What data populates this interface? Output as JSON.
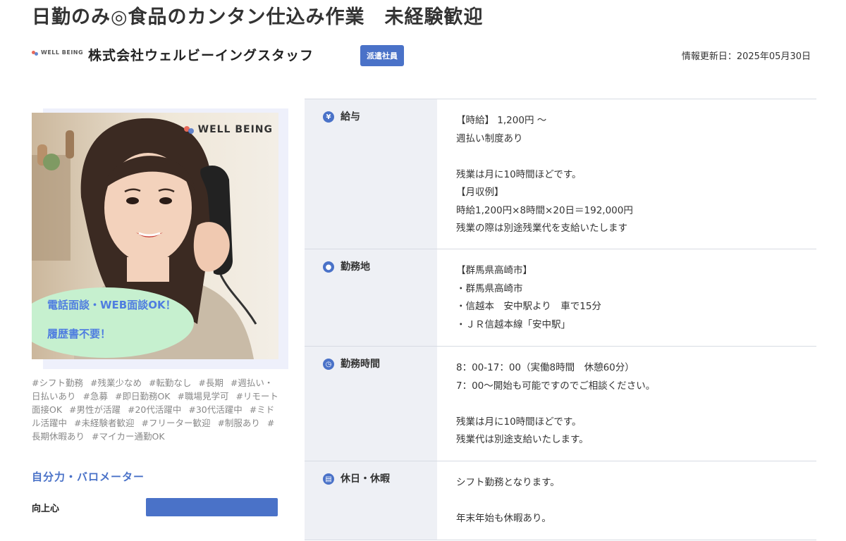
{
  "job": {
    "title": "日勤のみ◎食品のカンタン仕込み作業　未経験歓迎"
  },
  "company": {
    "logo_text": "WELL BEING",
    "name": "株式会社ウェルビーイングスタッフ",
    "employment_type": "派遣社員",
    "updated": "情報更新日：2025年05月30日"
  },
  "photo": {
    "brand": "WELL BEING",
    "bubble_line1": "電話面談・WEB面談OK！",
    "bubble_line2": "履歴書不要！"
  },
  "tags": [
    "#シフト勤務",
    "#残業少なめ",
    "#転勤なし",
    "#長期",
    "#週払い・日払いあり",
    "#急募",
    "#即日勤務OK",
    "#職場見学可",
    "#リモート面接OK",
    "#男性が活躍",
    "#20代活躍中",
    "#30代活躍中",
    "#ミドル活躍中",
    "#未経験者歓迎",
    "#フリーター歓迎",
    "#制服あり",
    "#長期休暇あり",
    "#マイカー通勤OK"
  ],
  "barometer": {
    "title": "自分力・バロメーター",
    "items": [
      {
        "label": "向上心",
        "level": 1.0
      }
    ]
  },
  "details": [
    {
      "icon": "yen-icon",
      "icon_glyph": "¥",
      "label": "給与",
      "lines": [
        "【時給】 1,200円 ～",
        "週払い制度あり",
        "",
        "残業は月に10時間ほどです。",
        "【月収例】",
        "時給1,200円×8時間×20日＝192,000円",
        "残業の際は別途残業代を支給いたします"
      ]
    },
    {
      "icon": "location-pin-icon",
      "icon_glyph": "●",
      "label": "勤務地",
      "lines": [
        "【群馬県高崎市】",
        "・群馬県高崎市",
        "・信越本　安中駅より　車で15分",
        "・ＪＲ信越本線「安中駅」"
      ]
    },
    {
      "icon": "clock-icon",
      "icon_glyph": "◷",
      "label": "勤務時間",
      "lines": [
        "8：00-17：00（実働8時間　休憩60分）",
        "7：00〜開始も可能ですのでご相談ください。",
        "",
        "残業は月に10時間ほどです。",
        "残業代は別途支給いたします。"
      ]
    },
    {
      "icon": "calendar-icon",
      "icon_glyph": "▤",
      "label": "休日・休暇",
      "lines": [
        "シフト勤務となります。",
        "",
        "年末年始も休暇あり。"
      ]
    }
  ],
  "colors": {
    "accent": "#4a72c8",
    "bubble": "#c6f0cf",
    "bubble_text": "#4f7de0",
    "table_head_bg": "#eef0f5"
  }
}
